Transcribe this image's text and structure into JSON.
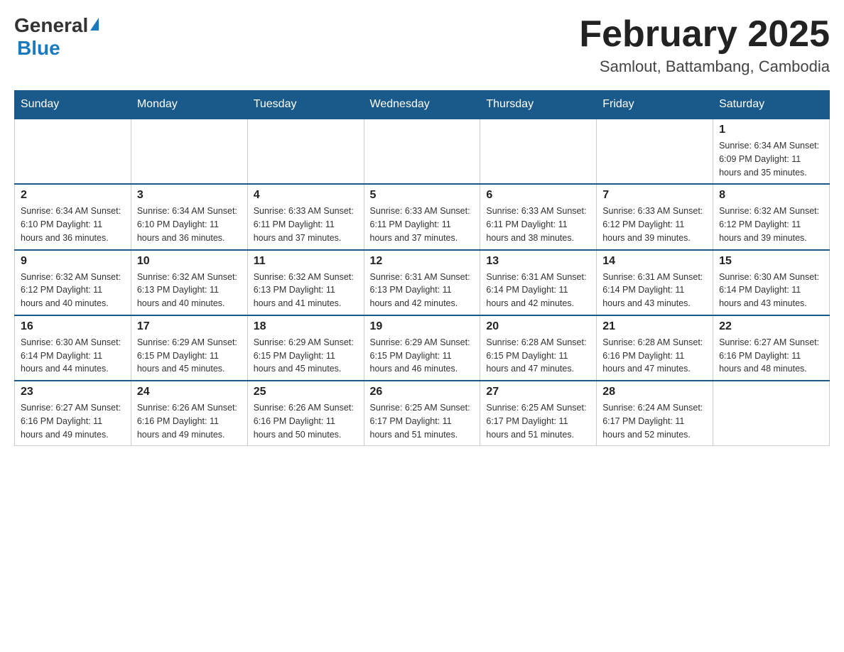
{
  "header": {
    "logo_general": "General",
    "logo_blue": "Blue",
    "month_title": "February 2025",
    "location": "Samlout, Battambang, Cambodia"
  },
  "days_of_week": [
    "Sunday",
    "Monday",
    "Tuesday",
    "Wednesday",
    "Thursday",
    "Friday",
    "Saturday"
  ],
  "weeks": [
    {
      "days": [
        {
          "num": "",
          "info": ""
        },
        {
          "num": "",
          "info": ""
        },
        {
          "num": "",
          "info": ""
        },
        {
          "num": "",
          "info": ""
        },
        {
          "num": "",
          "info": ""
        },
        {
          "num": "",
          "info": ""
        },
        {
          "num": "1",
          "info": "Sunrise: 6:34 AM\nSunset: 6:09 PM\nDaylight: 11 hours and 35 minutes."
        }
      ]
    },
    {
      "days": [
        {
          "num": "2",
          "info": "Sunrise: 6:34 AM\nSunset: 6:10 PM\nDaylight: 11 hours and 36 minutes."
        },
        {
          "num": "3",
          "info": "Sunrise: 6:34 AM\nSunset: 6:10 PM\nDaylight: 11 hours and 36 minutes."
        },
        {
          "num": "4",
          "info": "Sunrise: 6:33 AM\nSunset: 6:11 PM\nDaylight: 11 hours and 37 minutes."
        },
        {
          "num": "5",
          "info": "Sunrise: 6:33 AM\nSunset: 6:11 PM\nDaylight: 11 hours and 37 minutes."
        },
        {
          "num": "6",
          "info": "Sunrise: 6:33 AM\nSunset: 6:11 PM\nDaylight: 11 hours and 38 minutes."
        },
        {
          "num": "7",
          "info": "Sunrise: 6:33 AM\nSunset: 6:12 PM\nDaylight: 11 hours and 39 minutes."
        },
        {
          "num": "8",
          "info": "Sunrise: 6:32 AM\nSunset: 6:12 PM\nDaylight: 11 hours and 39 minutes."
        }
      ]
    },
    {
      "days": [
        {
          "num": "9",
          "info": "Sunrise: 6:32 AM\nSunset: 6:12 PM\nDaylight: 11 hours and 40 minutes."
        },
        {
          "num": "10",
          "info": "Sunrise: 6:32 AM\nSunset: 6:13 PM\nDaylight: 11 hours and 40 minutes."
        },
        {
          "num": "11",
          "info": "Sunrise: 6:32 AM\nSunset: 6:13 PM\nDaylight: 11 hours and 41 minutes."
        },
        {
          "num": "12",
          "info": "Sunrise: 6:31 AM\nSunset: 6:13 PM\nDaylight: 11 hours and 42 minutes."
        },
        {
          "num": "13",
          "info": "Sunrise: 6:31 AM\nSunset: 6:14 PM\nDaylight: 11 hours and 42 minutes."
        },
        {
          "num": "14",
          "info": "Sunrise: 6:31 AM\nSunset: 6:14 PM\nDaylight: 11 hours and 43 minutes."
        },
        {
          "num": "15",
          "info": "Sunrise: 6:30 AM\nSunset: 6:14 PM\nDaylight: 11 hours and 43 minutes."
        }
      ]
    },
    {
      "days": [
        {
          "num": "16",
          "info": "Sunrise: 6:30 AM\nSunset: 6:14 PM\nDaylight: 11 hours and 44 minutes."
        },
        {
          "num": "17",
          "info": "Sunrise: 6:29 AM\nSunset: 6:15 PM\nDaylight: 11 hours and 45 minutes."
        },
        {
          "num": "18",
          "info": "Sunrise: 6:29 AM\nSunset: 6:15 PM\nDaylight: 11 hours and 45 minutes."
        },
        {
          "num": "19",
          "info": "Sunrise: 6:29 AM\nSunset: 6:15 PM\nDaylight: 11 hours and 46 minutes."
        },
        {
          "num": "20",
          "info": "Sunrise: 6:28 AM\nSunset: 6:15 PM\nDaylight: 11 hours and 47 minutes."
        },
        {
          "num": "21",
          "info": "Sunrise: 6:28 AM\nSunset: 6:16 PM\nDaylight: 11 hours and 47 minutes."
        },
        {
          "num": "22",
          "info": "Sunrise: 6:27 AM\nSunset: 6:16 PM\nDaylight: 11 hours and 48 minutes."
        }
      ]
    },
    {
      "days": [
        {
          "num": "23",
          "info": "Sunrise: 6:27 AM\nSunset: 6:16 PM\nDaylight: 11 hours and 49 minutes."
        },
        {
          "num": "24",
          "info": "Sunrise: 6:26 AM\nSunset: 6:16 PM\nDaylight: 11 hours and 49 minutes."
        },
        {
          "num": "25",
          "info": "Sunrise: 6:26 AM\nSunset: 6:16 PM\nDaylight: 11 hours and 50 minutes."
        },
        {
          "num": "26",
          "info": "Sunrise: 6:25 AM\nSunset: 6:17 PM\nDaylight: 11 hours and 51 minutes."
        },
        {
          "num": "27",
          "info": "Sunrise: 6:25 AM\nSunset: 6:17 PM\nDaylight: 11 hours and 51 minutes."
        },
        {
          "num": "28",
          "info": "Sunrise: 6:24 AM\nSunset: 6:17 PM\nDaylight: 11 hours and 52 minutes."
        },
        {
          "num": "",
          "info": ""
        }
      ]
    }
  ]
}
